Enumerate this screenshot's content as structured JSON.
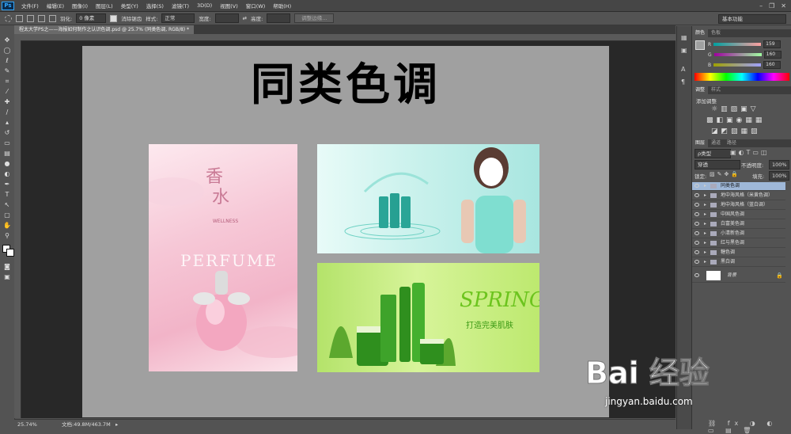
{
  "app": {
    "logo": "Ps"
  },
  "menu": [
    "文件(F)",
    "编辑(E)",
    "图像(I)",
    "图层(L)",
    "类型(Y)",
    "选择(S)",
    "滤镜(T)",
    "3D(D)",
    "视图(V)",
    "窗口(W)",
    "帮助(H)"
  ],
  "options": {
    "feather_label": "羽化:",
    "feather_value": "0 像素",
    "antialias_label": "消除锯齿",
    "style_label": "样式:",
    "style_value": "正常",
    "width_label": "宽度:",
    "height_label": "高度:",
    "refine_edge": "调整边缘...",
    "workspace": "基本功能"
  },
  "document": {
    "tab_title": "程太大学PS之——海报如何制作之认识色调.psd @ 25.7% (同类色调, RGB/8) *",
    "canvas_title": "同类色调",
    "zoom": "25.74%",
    "doc_size": "文档:49.8M/463.7M"
  },
  "images": {
    "pink": {
      "brand": "WELLNESS",
      "text": "PERFUME",
      "colors": [
        "#f6c7d6",
        "#fde9ef"
      ]
    },
    "cyan": {
      "colors": [
        "#c9f1ec",
        "#6fd2c4"
      ]
    },
    "green": {
      "title": "SPRING",
      "subtitle": "打造完美肌肤",
      "colors": [
        "#b4e36a",
        "#2f8f1e"
      ]
    }
  },
  "color_panel": {
    "tabs": [
      "颜色",
      "色板"
    ],
    "r_label": "R",
    "r_value": "159",
    "g_label": "G",
    "g_value": "160",
    "b_label": "B",
    "b_value": "160"
  },
  "adjust_panel": {
    "tabs": [
      "调整",
      "样式"
    ],
    "title": "添加调整"
  },
  "layers_panel": {
    "tabs": [
      "图层",
      "通道",
      "路径"
    ],
    "kind": "ρ类型",
    "blend": "穿透",
    "opacity_label": "不透明度:",
    "opacity_value": "100%",
    "lock_label": "锁定:",
    "fill_label": "填充:",
    "fill_value": "100%",
    "layers": [
      {
        "name": "同类色调",
        "selected": true,
        "group": true
      },
      {
        "name": "地中海风格（米黄色调）",
        "selected": false,
        "group": true
      },
      {
        "name": "地中海风格（蓝白调）",
        "selected": false,
        "group": true
      },
      {
        "name": "中国风色调",
        "selected": false,
        "group": true
      },
      {
        "name": "白富美色调",
        "selected": false,
        "group": true
      },
      {
        "name": "小清新色调",
        "selected": false,
        "group": true
      },
      {
        "name": "红与黑色调",
        "selected": false,
        "group": true
      },
      {
        "name": "糖色调",
        "selected": false,
        "group": true
      },
      {
        "name": "黑白调",
        "selected": false,
        "group": true
      },
      {
        "name": "背景",
        "selected": false,
        "group": false
      }
    ]
  },
  "watermark": {
    "logo": "Bai 经验",
    "url": "jingyan.baidu.com"
  }
}
